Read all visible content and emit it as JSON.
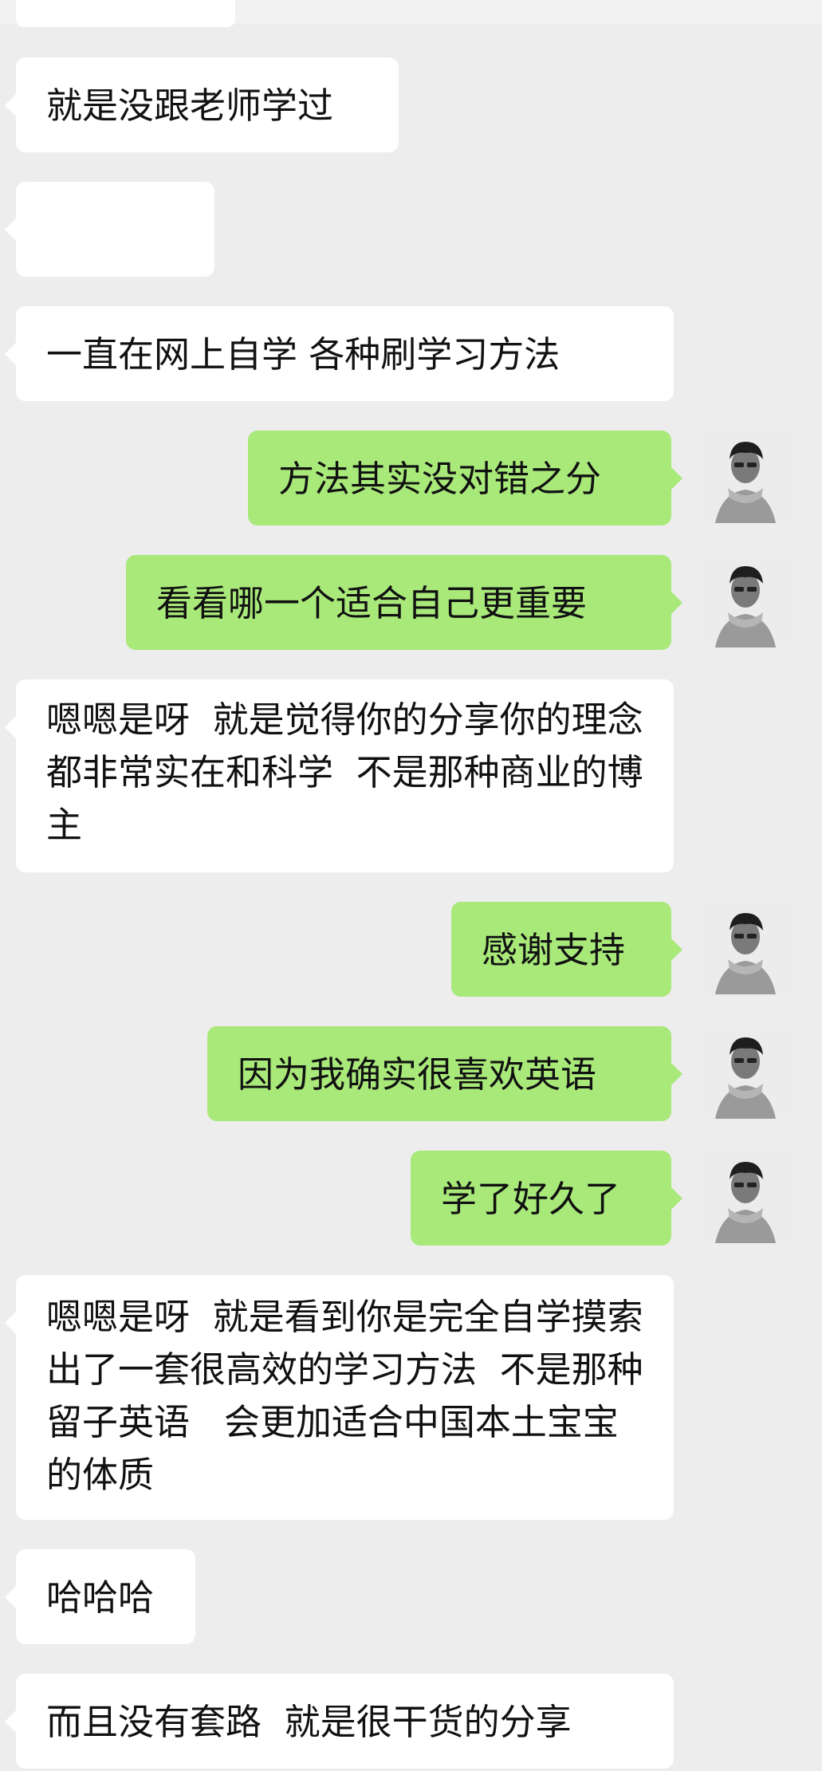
{
  "messages": [
    {
      "side": "in",
      "text": "就是没跟老师学过"
    },
    {
      "side": "in",
      "emoji": [
        "face-palm-tears-emoji",
        "face-palm-tears-emoji",
        "face-palm-tears-emoji"
      ]
    },
    {
      "side": "in",
      "text": "一直在网上自学 各种刷学习方法"
    },
    {
      "side": "out",
      "text": "方法其实没对错之分"
    },
    {
      "side": "out",
      "text": "看看哪一个适合自己更重要"
    },
    {
      "side": "in",
      "text": "嗯嗯是呀  就是觉得你的分享你的理念都非常实在和科学  不是那种商业的博主"
    },
    {
      "side": "out",
      "text": "感谢支持"
    },
    {
      "side": "out",
      "text": "因为我确实很喜欢英语"
    },
    {
      "side": "out",
      "text": "学了好久了"
    },
    {
      "side": "in",
      "text": "嗯嗯是呀  就是看到你是完全自学摸索出了一套很高效的学习方法  不是那种留子英语   会更加适合中国本土宝宝的体质"
    },
    {
      "side": "in",
      "text": "哈哈哈"
    },
    {
      "side": "in",
      "text": "而且没有套路  就是很干货的分享"
    }
  ],
  "colors": {
    "background": "#ededed",
    "incoming_bubble": "#ffffff",
    "outgoing_bubble": "#a9e97a"
  },
  "avatar_icon": "user-avatar-portrait"
}
